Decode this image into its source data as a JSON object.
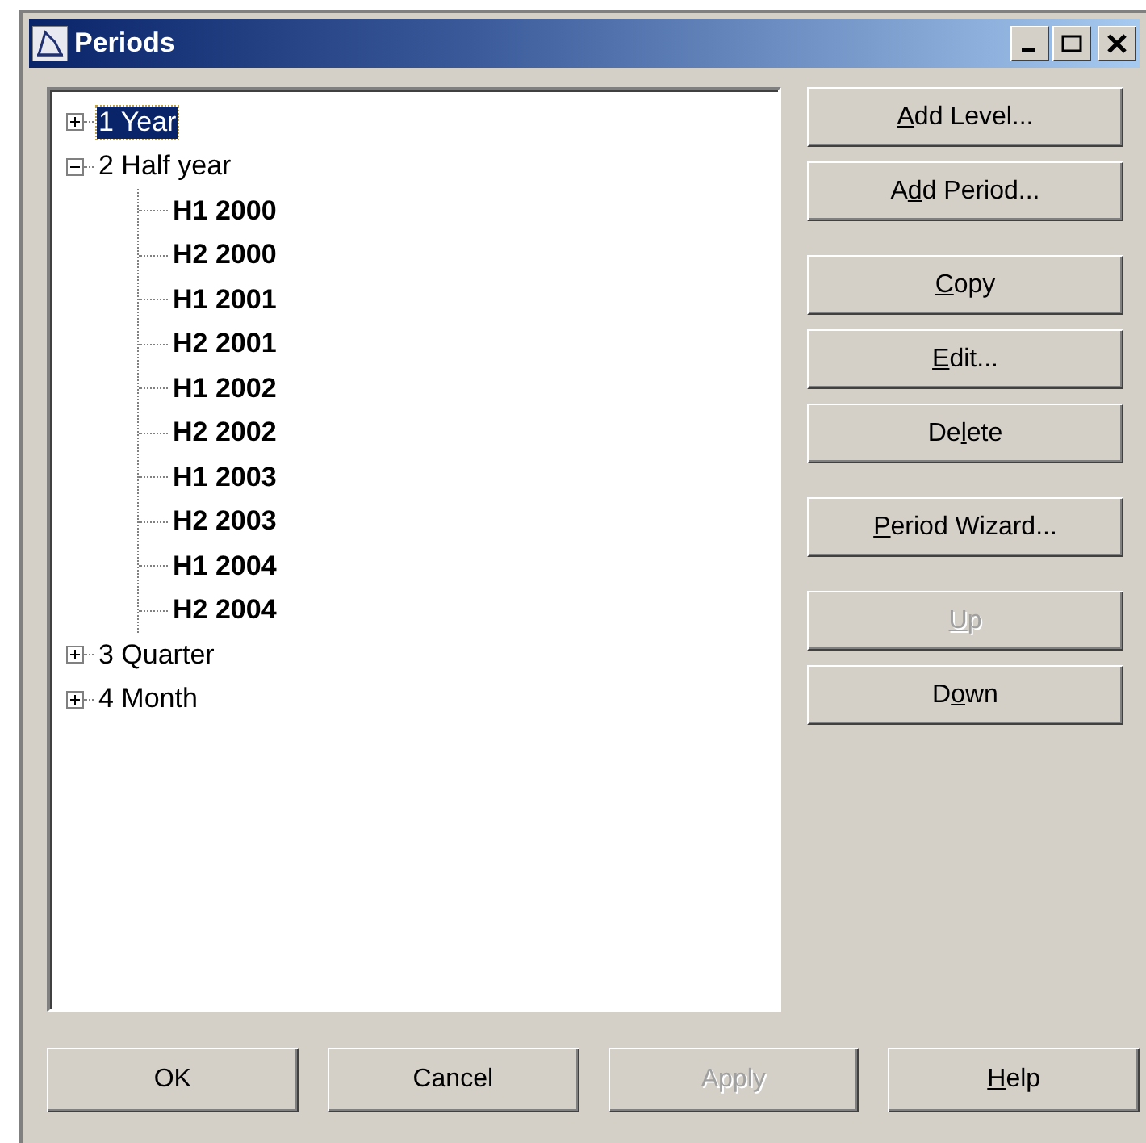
{
  "window": {
    "title": "Periods"
  },
  "tree": [
    {
      "label": "1 Year",
      "expanded": false,
      "selected": true
    },
    {
      "label": "2 Half year",
      "expanded": true,
      "selected": false,
      "children": [
        {
          "label": "H1 2000",
          "selected": false
        },
        {
          "label": "H2 2000",
          "selected": false
        },
        {
          "label": "H1 2001",
          "selected": false
        },
        {
          "label": "H2 2001",
          "selected": false
        },
        {
          "label": "H1 2002",
          "selected": false
        },
        {
          "label": "H2 2002",
          "selected": false
        },
        {
          "label": "H1 2003",
          "selected": false
        },
        {
          "label": "H2 2003",
          "selected": false
        },
        {
          "label": "H1 2004",
          "selected": false
        },
        {
          "label": "H2 2004",
          "selected": false
        }
      ]
    },
    {
      "label": "3 Quarter",
      "expanded": false,
      "selected": false
    },
    {
      "label": "4 Month",
      "expanded": false,
      "selected": false
    }
  ],
  "side_button_groups": [
    [
      {
        "key": "A",
        "post": "dd Level...",
        "disabled": false
      },
      {
        "pre": "A",
        "key": "d",
        "post": "d Period...",
        "disabled": false
      }
    ],
    [
      {
        "key": "C",
        "post": "opy",
        "disabled": false
      },
      {
        "key": "E",
        "post": "dit...",
        "disabled": false
      },
      {
        "pre": "De",
        "key": "l",
        "post": "ete",
        "disabled": false
      }
    ],
    [
      {
        "key": "P",
        "post": "eriod Wizard...",
        "disabled": false
      }
    ],
    [
      {
        "key": "U",
        "post": "p",
        "disabled": true
      },
      {
        "pre": "D",
        "key": "o",
        "post": "wn",
        "disabled": false
      }
    ]
  ],
  "bottom_buttons": [
    {
      "pre": "OK",
      "disabled": false
    },
    {
      "pre": "Cancel",
      "disabled": false
    },
    {
      "pre": "Apply",
      "disabled": true
    },
    {
      "key": "H",
      "post": "elp",
      "disabled": false
    }
  ]
}
